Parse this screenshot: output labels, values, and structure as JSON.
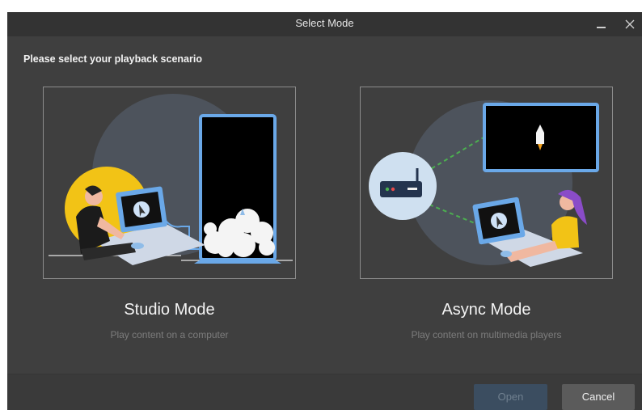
{
  "window": {
    "title": "Select Mode",
    "minimize_icon": "minimize-icon",
    "close_icon": "close-icon"
  },
  "prompt": "Please select your playback scenario",
  "modes": [
    {
      "title": "Studio Mode",
      "description": "Play content on a computer",
      "illustration": "person-at-computer-connected-to-led-screen"
    },
    {
      "title": "Async Mode",
      "description": "Play content on multimedia players",
      "illustration": "multimedia-player-router-to-screen-and-computer"
    }
  ],
  "footer": {
    "open_label": "Open",
    "cancel_label": "Cancel",
    "open_enabled": false
  },
  "colors": {
    "background": "#3f3f3f",
    "titlebar": "#333333",
    "accent_blue": "#6aa8e8",
    "yellow": "#f2c316",
    "open_disabled": "#3b4d60",
    "cancel": "#5b5b5b"
  }
}
